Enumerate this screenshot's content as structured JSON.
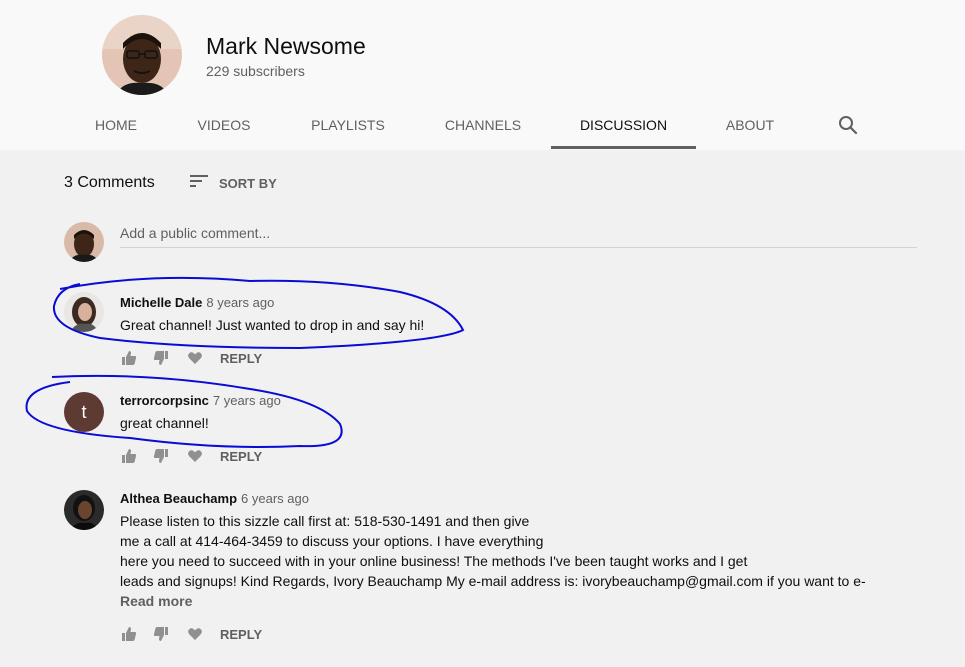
{
  "channel": {
    "name": "Mark Newsome",
    "subscribers": "229 subscribers"
  },
  "tabs": [
    {
      "label": "HOME"
    },
    {
      "label": "VIDEOS"
    },
    {
      "label": "PLAYLISTS"
    },
    {
      "label": "CHANNELS"
    },
    {
      "label": "DISCUSSION",
      "active": true
    },
    {
      "label": "ABOUT"
    }
  ],
  "discussion": {
    "count_label": "3 Comments",
    "sort_label": "SORT BY",
    "add_placeholder": "Add a public comment..."
  },
  "comments": [
    {
      "author": "Michelle Dale",
      "time": "8 years ago",
      "lines": [
        "Great channel! Just wanted to drop in and say hi!"
      ],
      "reply": "REPLY"
    },
    {
      "author": "terrorcorpsinc",
      "avatar_letter": "t",
      "avatar_color": "#5d3a32",
      "time": "7 years ago",
      "lines": [
        "great channel!"
      ],
      "reply": "REPLY"
    },
    {
      "author": "Althea Beauchamp",
      "time": "6 years ago",
      "lines": [
        "Please listen to this sizzle call first at: 518-530-1491 and then give",
        "me a call at 414-464-3459 to discuss your options. I have everything",
        "here you need to succeed with in your online business! The methods I've been taught works and I get",
        "leads and signups! Kind Regards, Ivory Beauchamp My e-mail address is: ivorybeauchamp@gmail.com if you want to e-"
      ],
      "read_more": "Read more",
      "reply": "REPLY"
    }
  ],
  "icons": {
    "search": "search-icon",
    "sort": "sort-icon",
    "like": "thumb-up-icon",
    "dislike": "thumb-down-icon",
    "heart": "heart-icon"
  },
  "colors": {
    "annotation": "#0b0bd6"
  }
}
